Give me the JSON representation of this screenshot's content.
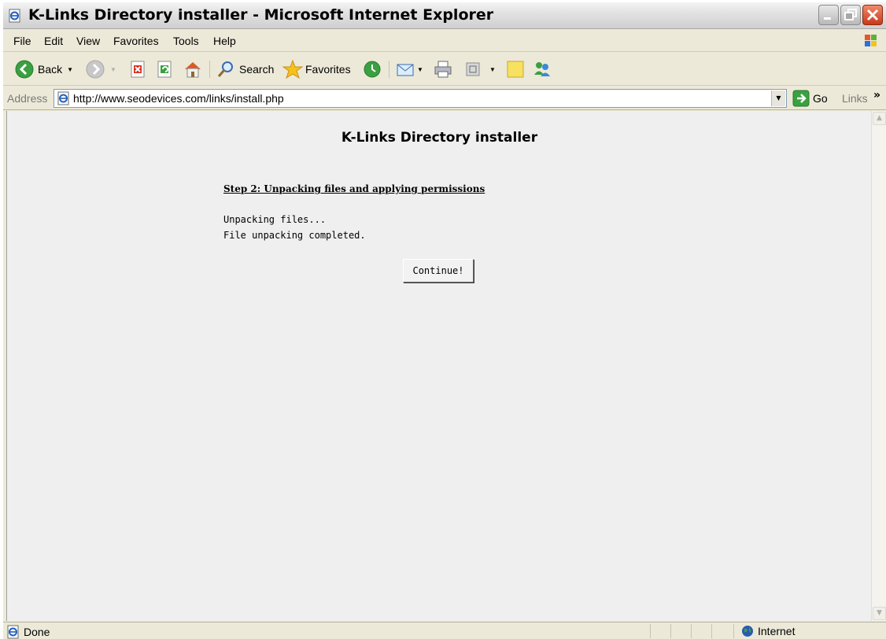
{
  "window": {
    "title": "K-Links Directory installer - Microsoft Internet Explorer"
  },
  "menu": {
    "items": [
      "File",
      "Edit",
      "View",
      "Favorites",
      "Tools",
      "Help"
    ]
  },
  "toolbar": {
    "back_label": "Back",
    "search_label": "Search",
    "favorites_label": "Favorites"
  },
  "address": {
    "label": "Address",
    "url": "http://www.seodevices.com/links/install.php",
    "go_label": "Go",
    "links_label": "Links"
  },
  "page": {
    "heading": "K-Links Directory installer",
    "step_title": "Step 2: Unpacking files and applying permissions",
    "status_lines": [
      "Unpacking files...",
      "File unpacking completed."
    ],
    "continue_label": "Continue!"
  },
  "status": {
    "left_text": "Done",
    "zone_text": "Internet"
  },
  "colors": {
    "content_bg": "#efefef",
    "chrome_bg": "#ece9d8",
    "close_button": "#c8381a"
  }
}
